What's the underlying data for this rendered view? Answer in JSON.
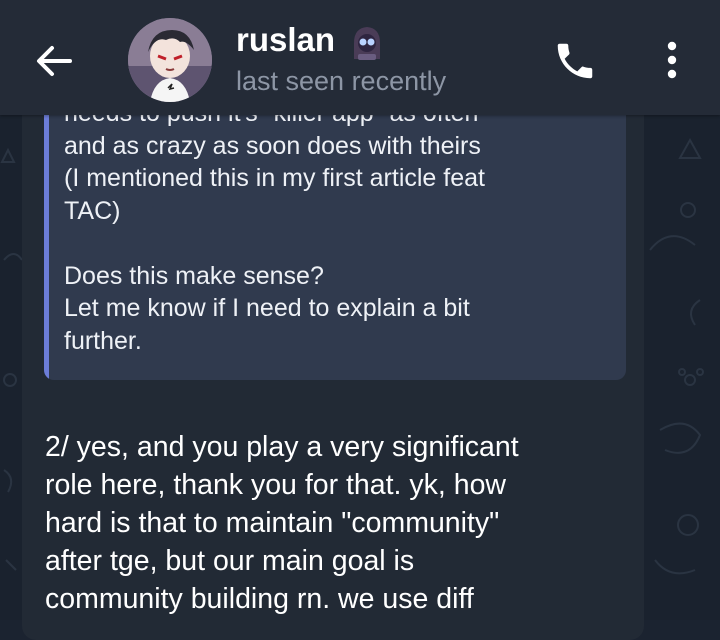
{
  "header": {
    "contact_name": "ruslan",
    "status": "last seen recently",
    "icons": {
      "back": "arrow-left-icon",
      "call": "phone-icon",
      "menu": "more-vertical-icon",
      "status_emoji": "hooded-figure-emoji"
    }
  },
  "message": {
    "quote_lines": [
      "needs to push it's \"killer app\" as often",
      "and as crazy as soon does with theirs",
      "(I mentioned this in my first article feat",
      "TAC)",
      "",
      "Does this make sense?",
      "Let me know if I need to explain a bit",
      "further."
    ],
    "body_lines": [
      "2/ yes, and you play a very significant",
      "role here, thank you for that. yk, how",
      "hard is that to maintain \"community\"",
      "after tge, but our main goal is",
      "community building rn. we use diff"
    ]
  },
  "colors": {
    "header_bg": "#242b37",
    "bubble_bg": "#222a35",
    "quote_bg": "#303a4e",
    "quote_bar": "#6c7dd8",
    "text": "#ffffff",
    "muted": "#8d96a5"
  }
}
